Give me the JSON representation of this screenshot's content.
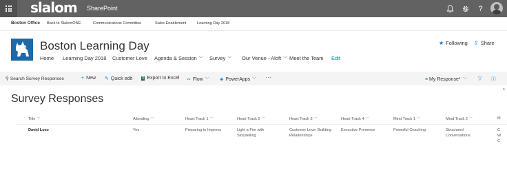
{
  "suitebar": {
    "brand": "slalom",
    "app_name": "SharePoint",
    "icons": [
      "app-launcher-icon",
      "bell-icon",
      "gear-icon",
      "help-icon",
      "user-avatar"
    ]
  },
  "hubnav": {
    "items": [
      "Boston Office",
      "Back to SlalomONE",
      "Communications Committee",
      "Sales Enablement",
      "Learning Day 2018"
    ]
  },
  "site": {
    "title": "Boston Learning Day",
    "nav": [
      "Home",
      "Learning Day 2018",
      "Customer Love",
      "Agenda & Session",
      "Survey",
      "Our Venue - Aloft",
      "Meet the Team",
      "Edit"
    ],
    "following_label": "Following",
    "share_label": "Share"
  },
  "commandbar": {
    "search_placeholder": "Search Survey Responses",
    "new_label": "New",
    "quick_edit_label": "Quick edit",
    "export_label": "Export to Excel",
    "flow_label": "Flow",
    "powerapps_label": "PowerApps",
    "more_label": "···",
    "view_label": "My Response*"
  },
  "list": {
    "title": "Survey Responses",
    "columns": [
      "Title",
      "Attending",
      "Heart Track 1",
      "Heart Track 2",
      "Heart Track 3",
      "Heart Track 4",
      "Mind Track 1",
      "Mind Track 2",
      "M"
    ],
    "rows": [
      [
        "David Lozo",
        "Yes",
        "Preparing to Impress",
        "Light a Fire with Storytelling",
        "Customer Love: Building Relationships",
        "Executive Presence",
        "Powerful Coaching",
        "Structured Conversations",
        "C W C"
      ]
    ]
  },
  "colors": {
    "suitebar": "#626262",
    "accent": "#0078d4",
    "logo": "#1e6aa8"
  }
}
